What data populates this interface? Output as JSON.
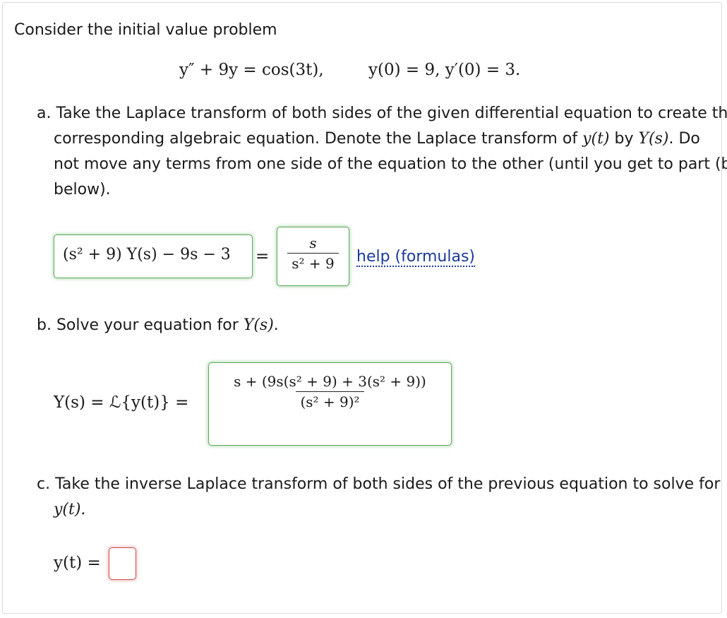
{
  "intro": "Consider the initial value problem",
  "ivp": {
    "equation": "y″ + 9y = cos(3t),",
    "conditions": "y(0) = 9,   y′(0) = 3."
  },
  "part_a": {
    "text_line1": "a. Take the Laplace transform of both sides of the given differential equation to create the",
    "text_line2_pre": "corresponding algebraic equation. Denote the Laplace transform of ",
    "text_line2_y": "y(t)",
    "text_line2_mid": " by ",
    "text_line2_Y": "Y(s)",
    "text_line2_post": ". Do",
    "text_line3": "not move any terms from one side of the equation to the other (until you get to part (b)",
    "text_line4": "below).",
    "lhs_answer": "(s² + 9) Y(s) − 9s − 3",
    "equals": "=",
    "rhs_num": "s",
    "rhs_den": "s² + 9",
    "help_link": "help (formulas)"
  },
  "part_b": {
    "text_pre": "b. Solve your equation for ",
    "text_Y": "Y(s)",
    "text_post": ".",
    "label": "Y(s) = ℒ{y(t)} =",
    "answer_num": "s + (9s(s² + 9) + 3(s² + 9))",
    "answer_den": "(s² + 9)²"
  },
  "part_c": {
    "text_line1": "c. Take the inverse Laplace transform of both sides of the previous equation to solve for",
    "text_line2": "y(t).",
    "label": "y(t) =",
    "answer_value": ""
  }
}
